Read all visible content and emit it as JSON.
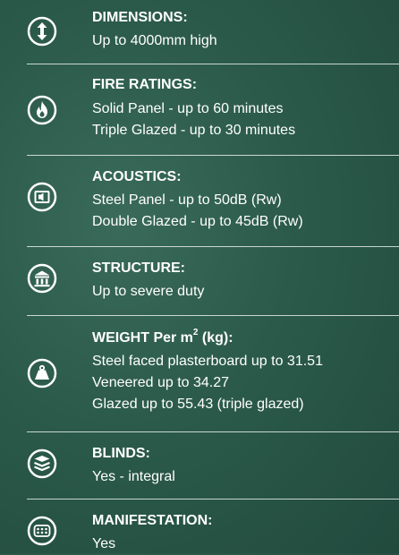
{
  "specs": [
    {
      "title": "DIMENSIONS:",
      "lines": [
        "Up to 4000mm high"
      ],
      "icon": "height-arrows-icon"
    },
    {
      "title": "FIRE RATINGS:",
      "lines": [
        "Solid Panel - up to 60 minutes",
        "Triple Glazed - up to 30 minutes"
      ],
      "icon": "flame-icon"
    },
    {
      "title": "ACOUSTICS:",
      "lines": [
        "Steel Panel - up to 50dB (Rw)",
        "Double Glazed - up to 45dB (Rw)"
      ],
      "icon": "speaker-icon"
    },
    {
      "title": "STRUCTURE:",
      "lines": [
        "Up to severe duty"
      ],
      "icon": "building-icon"
    },
    {
      "title_prefix": "WEIGHT Per m",
      "title_sup": "2",
      "title_suffix": " (kg):",
      "lines": [
        "Steel faced plasterboard up to 31.51",
        "Veneered up to 34.27",
        "Glazed up to 55.43 (triple glazed)"
      ],
      "icon": "weight-icon"
    },
    {
      "title": "BLINDS:",
      "lines": [
        "Yes - integral"
      ],
      "icon": "blinds-layers-icon"
    },
    {
      "title": "MANIFESTATION:",
      "lines": [
        "Yes"
      ],
      "icon": "dots-pattern-icon"
    }
  ],
  "colors": {
    "background": "#2b5a4a",
    "text": "#ffffff",
    "divider": "#ffffff"
  }
}
